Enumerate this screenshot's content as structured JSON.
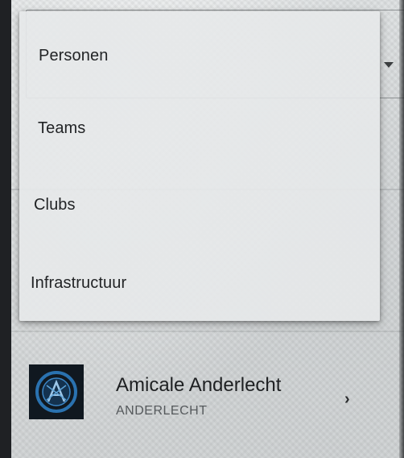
{
  "dropdown": {
    "items": [
      {
        "label": "Personen"
      },
      {
        "label": "Teams"
      },
      {
        "label": "Clubs"
      },
      {
        "label": "Infrastructuur"
      }
    ]
  },
  "club": {
    "name": "Amicale Anderlecht",
    "city": "ANDERLECHT",
    "logo_icon": "club-crest-icon",
    "chevron_icon": "chevron-right-icon"
  },
  "colors": {
    "logo_background": "#101820",
    "logo_accent": "#2a72b0"
  }
}
